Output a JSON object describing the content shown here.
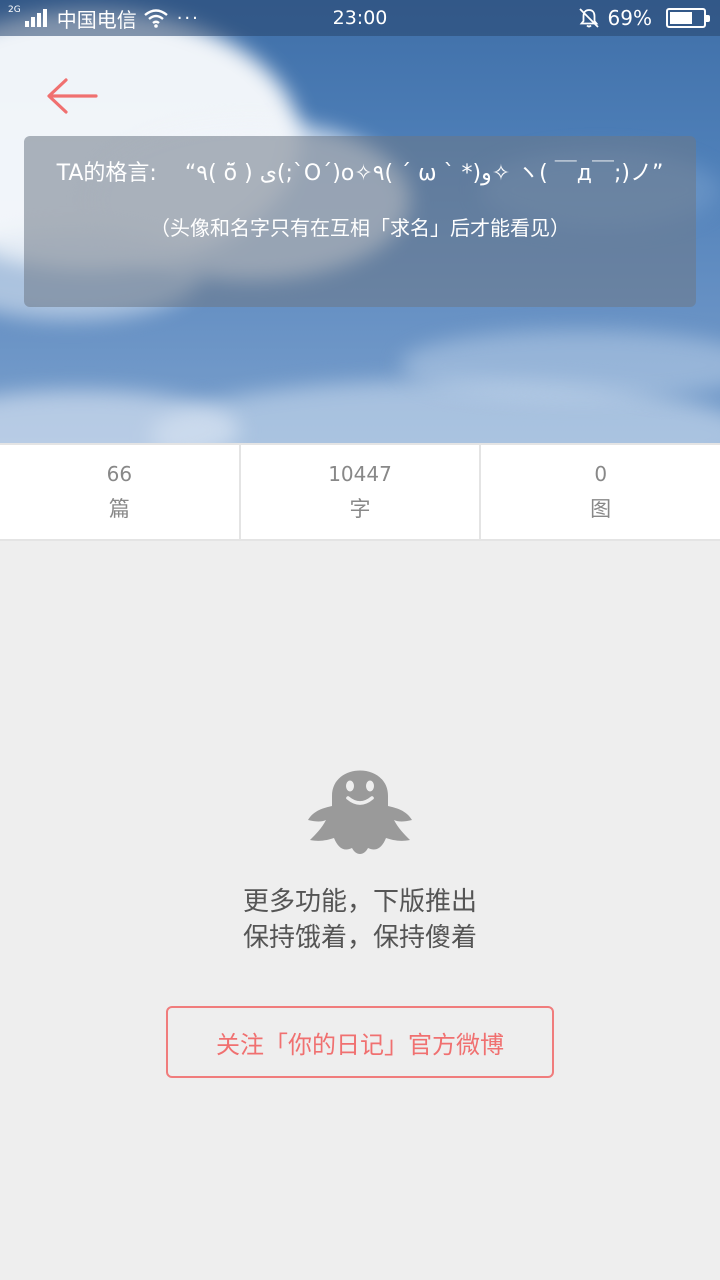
{
  "status_bar": {
    "network_type": "2G",
    "carrier": "中国电信",
    "more": "···",
    "time": "23:00",
    "battery_text": "69%",
    "battery_level": 0.69
  },
  "header": {
    "motto_label": "TA的格言:",
    "motto_text": "“٩( ö̆ ) ی(;`O´)o✧٩( ´ ω ` *)و✧ ヽ( ￣д￣;)ノ”",
    "note": "（头像和名字只有在互相「求名」后才能看见）"
  },
  "stats": [
    {
      "value": "66",
      "label": "篇"
    },
    {
      "value": "10447",
      "label": "字"
    },
    {
      "value": "0",
      "label": "图"
    }
  ],
  "empty_state": {
    "icon": "ghost-icon",
    "line1": "更多功能，下版推出",
    "line2": "保持饿着，保持傻着"
  },
  "follow_button": {
    "label": "关注「你的日记」官方微博"
  },
  "colors": {
    "accent": "#f07070",
    "background": "#eeeeee",
    "ghost": "#9a9a9a"
  }
}
